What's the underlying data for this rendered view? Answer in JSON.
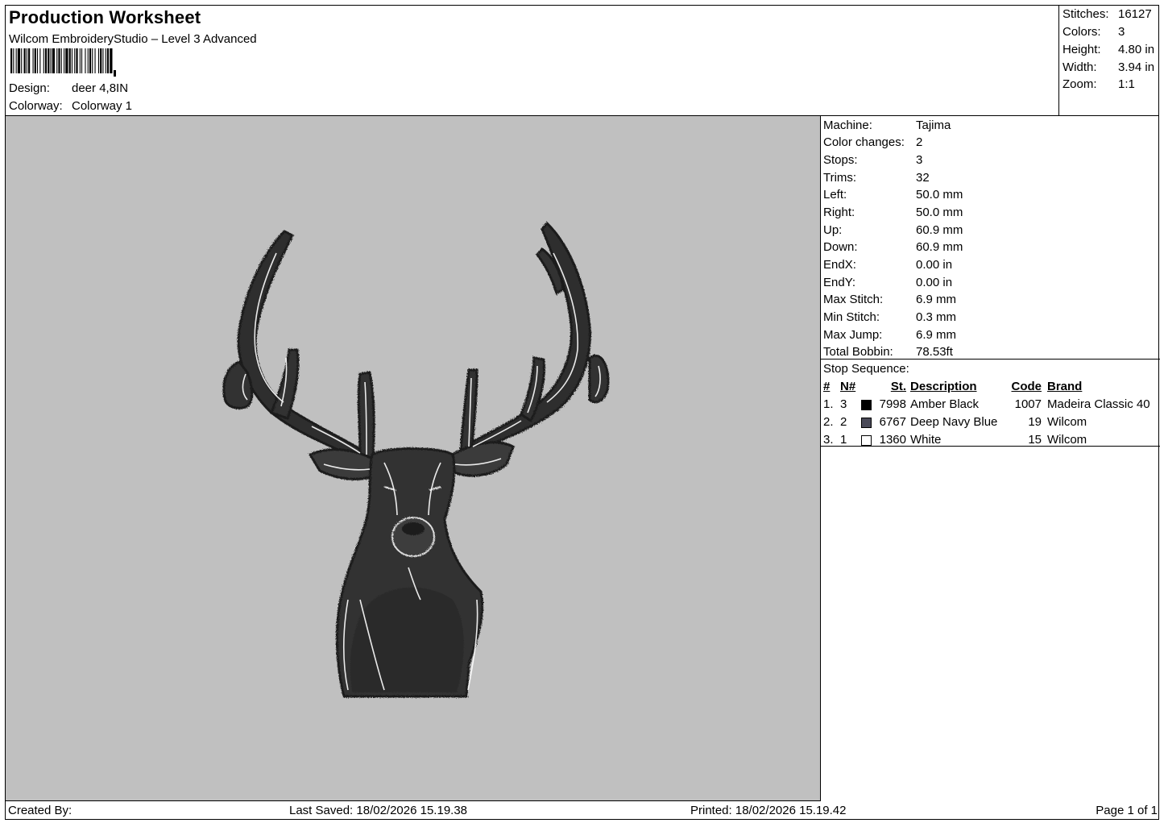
{
  "header": {
    "title": "Production Worksheet",
    "software": "Wilcom EmbroideryStudio – Level 3 Advanced",
    "design_label": "Design:",
    "design_value": "deer 4,8IN",
    "colorway_label": "Colorway:",
    "colorway_value": "Colorway 1"
  },
  "stats": [
    {
      "label": "Stitches:",
      "value": "16127"
    },
    {
      "label": "Colors:",
      "value": "3"
    },
    {
      "label": "Height:",
      "value": "4.80 in"
    },
    {
      "label": "Width:",
      "value": "3.94 in"
    },
    {
      "label": "Zoom:",
      "value": "1:1"
    }
  ],
  "machine_info": [
    {
      "label": "Machine:",
      "value": "Tajima"
    },
    {
      "label": "Color changes:",
      "value": "2"
    },
    {
      "label": "Stops:",
      "value": "3"
    },
    {
      "label": "Trims:",
      "value": "32"
    },
    {
      "label": "Left:",
      "value": "50.0 mm"
    },
    {
      "label": "Right:",
      "value": "50.0 mm"
    },
    {
      "label": "Up:",
      "value": "60.9 mm"
    },
    {
      "label": "Down:",
      "value": "60.9 mm"
    },
    {
      "label": "EndX:",
      "value": "0.00 in"
    },
    {
      "label": "EndY:",
      "value": "0.00 in"
    },
    {
      "label": "Max Stitch:",
      "value": "6.9 mm"
    },
    {
      "label": "Min Stitch:",
      "value": "0.3 mm"
    },
    {
      "label": "Max Jump:",
      "value": "6.9 mm"
    },
    {
      "label": "Total Bobbin:",
      "value": "78.53ft"
    }
  ],
  "stop_sequence": {
    "title": "Stop Sequence:",
    "headers": {
      "idx": "#",
      "n": "N#",
      "st": "St.",
      "desc": "Description",
      "code": "Code",
      "brand": "Brand"
    },
    "rows": [
      {
        "idx": "1.",
        "n": "3",
        "swatch": "#000000",
        "st": "7998",
        "desc": "Amber Black",
        "code": "1007",
        "brand": "Madeira Classic 40"
      },
      {
        "idx": "2.",
        "n": "2",
        "swatch": "#4a4a58",
        "st": "6767",
        "desc": "Deep Navy Blue",
        "code": "19",
        "brand": "Wilcom"
      },
      {
        "idx": "3.",
        "n": "1",
        "swatch": "#ffffff",
        "st": "1360",
        "desc": "White",
        "code": "15",
        "brand": "Wilcom"
      }
    ]
  },
  "footer": {
    "created_by": "Created By:",
    "last_saved": "Last Saved: 18/02/2026 15.19.38",
    "printed": "Printed: 18/02/2026 15.19.42",
    "page": "Page 1 of 1"
  },
  "colors": {
    "preview_background": "#c0c0c0",
    "thread_dark": "#2b2b2b",
    "thread_mid": "#4a4a58",
    "thread_light": "#ffffff"
  }
}
